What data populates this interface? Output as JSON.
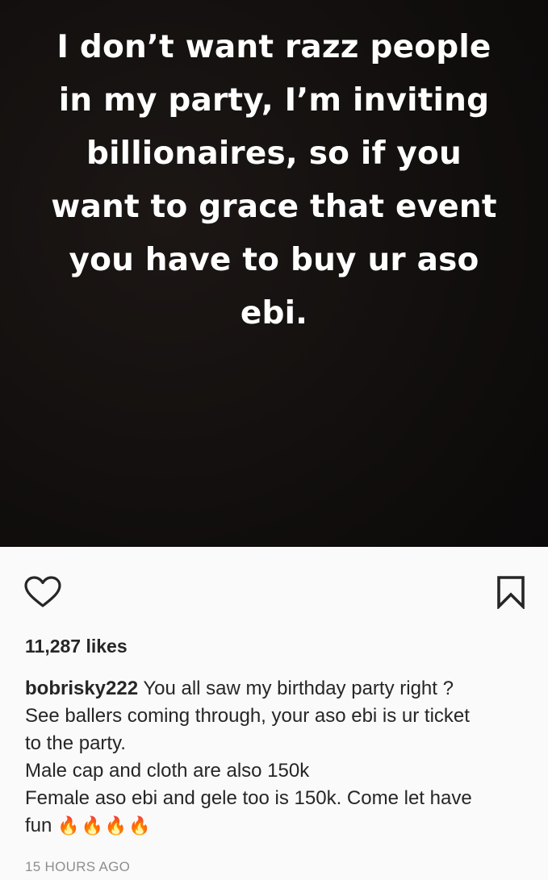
{
  "story": {
    "lines": [
      "I don’t want razz people",
      "in my party, I’m inviting",
      "billionaires, so if you",
      "want to grace that event",
      "you have to buy ur aso",
      "ebi."
    ]
  },
  "actions": {
    "like_icon": "heart-outline-icon",
    "save_icon": "bookmark-outline-icon"
  },
  "likes": "11,287 likes",
  "caption": {
    "username": "bobrisky222",
    "lines": [
      "You all saw my birthday party right ?",
      "See ballers coming through, your aso ebi is ur ticket",
      "to the party.",
      "Male cap and cloth are also 150k",
      "Female aso ebi and gele too is 150k. Come let have",
      "fun"
    ],
    "emoji": "🔥🔥🔥🔥"
  },
  "timestamp": "15 HOURS AGO",
  "colors": {
    "text": "#262626",
    "muted": "#8e8e8e",
    "background": "#fafafa",
    "image_bg": "#120f0e"
  }
}
